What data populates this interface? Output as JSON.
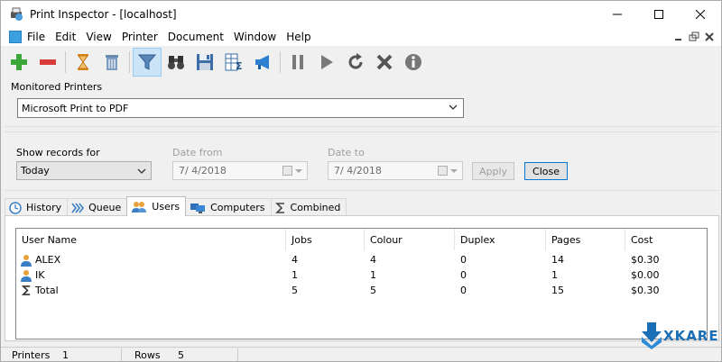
{
  "window": {
    "title": "Print Inspector - [localhost]",
    "controls": {
      "minimize": "—",
      "maximize": "☐",
      "close": "✕"
    }
  },
  "menu": {
    "items": [
      "File",
      "Edit",
      "View",
      "Printer",
      "Document",
      "Window",
      "Help"
    ]
  },
  "toolbar": {
    "icons": [
      "add-icon",
      "remove-icon",
      "hourglass-icon",
      "trash-icon",
      "filter-icon",
      "binoculars-icon",
      "save-icon",
      "sum-table-icon",
      "megaphone-icon",
      "pause-icon",
      "play-icon",
      "restart-icon",
      "cancel-icon",
      "info-icon"
    ],
    "active": "filter-icon"
  },
  "printers": {
    "label": "Monitored Printers",
    "selected": "Microsoft Print to PDF"
  },
  "filter": {
    "show_label": "Show records for",
    "show_value": "Today",
    "date_from_label": "Date from",
    "date_from_value": "7/  4/2018",
    "date_to_label": "Date to",
    "date_to_value": "7/  4/2018",
    "apply_label": "Apply",
    "close_label": "Close"
  },
  "tabs": [
    {
      "label": "History",
      "icon": "clock-icon",
      "active": false
    },
    {
      "label": "Queue",
      "icon": "queue-icon",
      "active": false
    },
    {
      "label": "Users",
      "icon": "users-icon",
      "active": true
    },
    {
      "label": "Computers",
      "icon": "computers-icon",
      "active": false
    },
    {
      "label": "Combined",
      "icon": "sigma-icon",
      "active": false
    }
  ],
  "table": {
    "columns": [
      "User Name",
      "Jobs",
      "Colour",
      "Duplex",
      "Pages",
      "Cost"
    ],
    "rows": [
      {
        "icon": "user-icon",
        "cells": [
          "ALEX",
          "4",
          "4",
          "0",
          "14",
          "$0.30"
        ]
      },
      {
        "icon": "user-icon",
        "cells": [
          "IK",
          "1",
          "1",
          "0",
          "1",
          "$0.00"
        ]
      },
      {
        "icon": "sigma-icon",
        "cells": [
          "Total",
          "5",
          "5",
          "0",
          "15",
          "$0.30"
        ]
      }
    ]
  },
  "status": {
    "printers_label": "Printers",
    "printers_value": "1",
    "rows_label": "Rows",
    "rows_value": "5"
  },
  "logo": {
    "text": "XKARE"
  },
  "colors": {
    "accent": "#0078d7",
    "logo": "#1b6fb5",
    "selected_tool": "#cce4f7"
  }
}
